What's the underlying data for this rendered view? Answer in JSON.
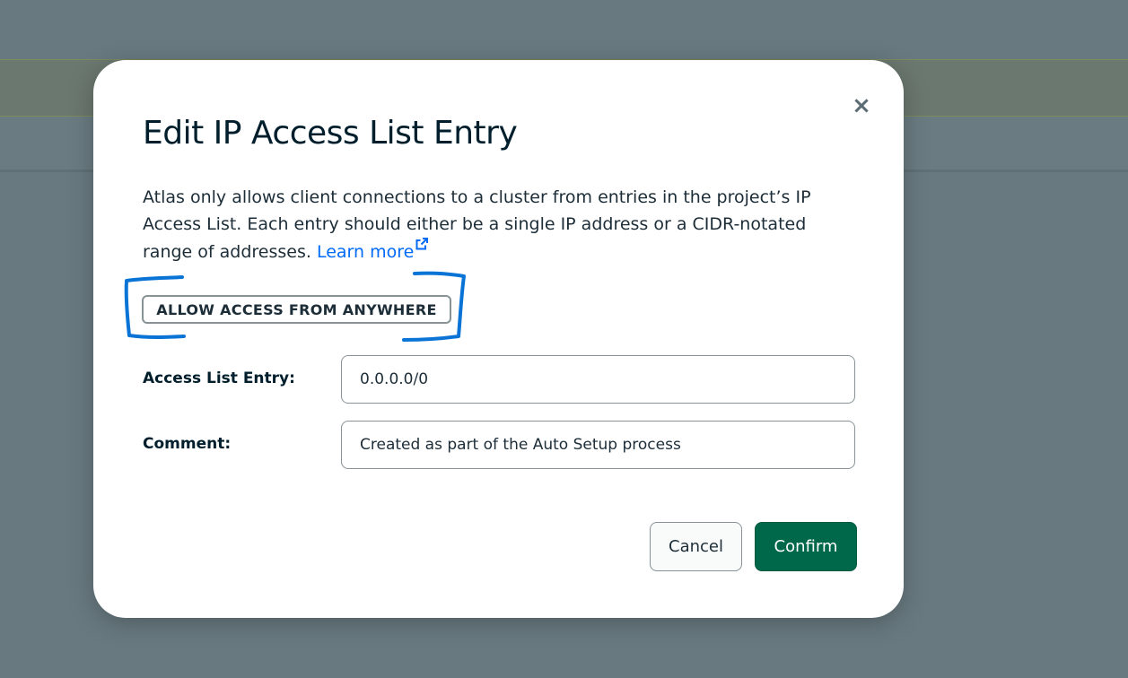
{
  "colors": {
    "backdrop": "#687a80",
    "link": "#016bf8",
    "confirm_bg": "#00684a",
    "annotation_stroke": "#0a74d6"
  },
  "modal": {
    "title": "Edit IP Access List Entry",
    "close_icon": "×",
    "description": {
      "line1": "Atlas only allows client connections to a cluster from entries in the project’s IP",
      "line2": "Access List. Each entry should either be a single IP address or a CIDR-notated",
      "line3_prefix": "range of addresses. ",
      "learn_more": "Learn more",
      "learn_more_icon": "external-link-icon"
    },
    "allow_anywhere_label": "ALLOW ACCESS FROM ANYWHERE",
    "fields": {
      "access_list_entry": {
        "label": "Access List Entry:",
        "value": "0.0.0.0/0"
      },
      "comment": {
        "label": "Comment:",
        "value": "Created as part of the Auto Setup process"
      }
    },
    "buttons": {
      "cancel": "Cancel",
      "confirm": "Confirm"
    }
  }
}
